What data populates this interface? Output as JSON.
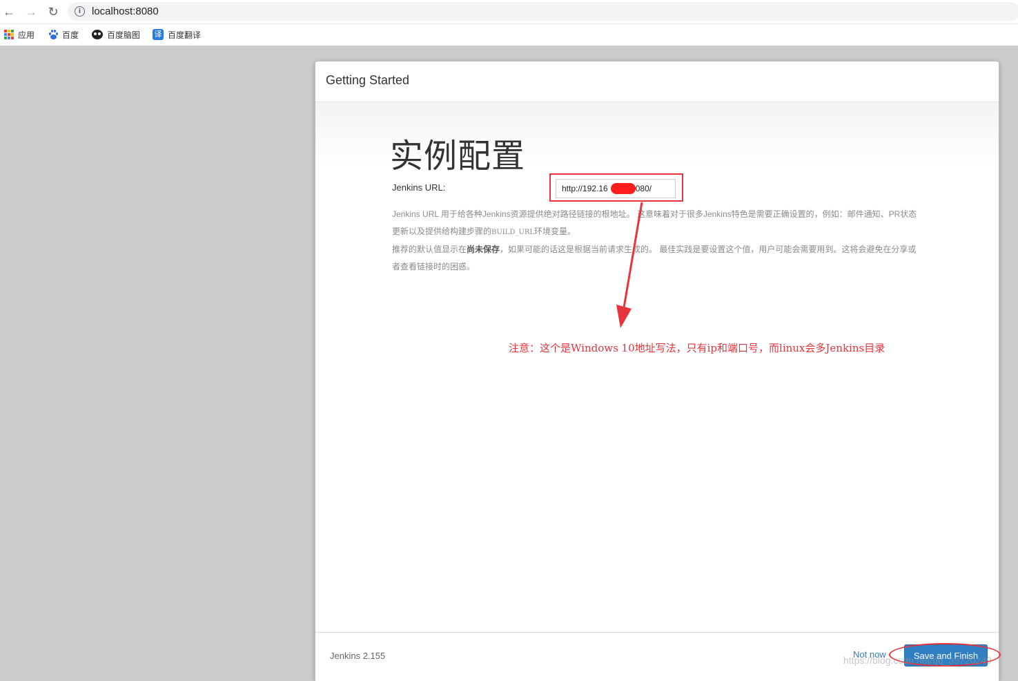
{
  "browser": {
    "back_icon": "←",
    "forward_icon": "→",
    "reload_icon": "↻",
    "info_icon": "i",
    "url": "localhost:8080"
  },
  "bookmarks": [
    {
      "label": "应用",
      "icon": "apps-icon"
    },
    {
      "label": "百度",
      "icon": "baidu-paw-icon"
    },
    {
      "label": "百度脑图",
      "icon": "panda-icon"
    },
    {
      "label": "百度翻译",
      "icon": "translate-icon",
      "icon_text": "译"
    }
  ],
  "dialog": {
    "title": "Getting Started",
    "heading": "实例配置",
    "field_label": "Jenkins URL:",
    "url_value": "http://192.16         :8080/",
    "help_line1_a": "Jenkins URL 用于给各种Jenkins资源提供绝对路径链接的根地址。 这意味着对于很多Jenkins特色是需要正确设置的，例如：邮件通知、PR状态更新以及提供给构建步骤的",
    "help_line1_code": "BUILD_URL",
    "help_line1_b": "环境变量。",
    "help_line2_a": "推荐的默认值显示在",
    "help_line2_bold": "尚未保存",
    "help_line2_b": "，如果可能的话这是根据当前请求生成的。 最佳实践是要设置这个值，用户可能会需要用到。这将会避免在分享或者查看链接时的困惑。",
    "annotation": "注意：这个是Windows 10地址写法，只有ip和端口号，而linux会多Jenkins目录",
    "version": "Jenkins 2.155",
    "not_now": "Not now",
    "save_button": "Save and Finish"
  },
  "watermark": "https://blog.csdn.net/qq_39720249",
  "colors": {
    "annotation_red": "#e8333b",
    "primary_button": "#2f7fc2",
    "link": "#337ab7"
  }
}
